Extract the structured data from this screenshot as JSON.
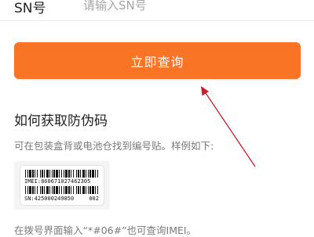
{
  "sn_field": {
    "label": "SN号",
    "placeholder": "请输入SN号",
    "value": ""
  },
  "query_button": {
    "label": "立即查询"
  },
  "help": {
    "title": "如何获取防伪码",
    "description": "可在包装盒背或电池仓找到编号贴。样例如下:",
    "sample_label": {
      "imei": "IMEI:860671027462305",
      "sn": "SN:425000249850",
      "code": "002"
    },
    "footer": "在拨号界面输入“*#06#”也可查询IMEI。"
  },
  "colors": {
    "accent": "#f97425",
    "annotation": "#c8202a"
  }
}
